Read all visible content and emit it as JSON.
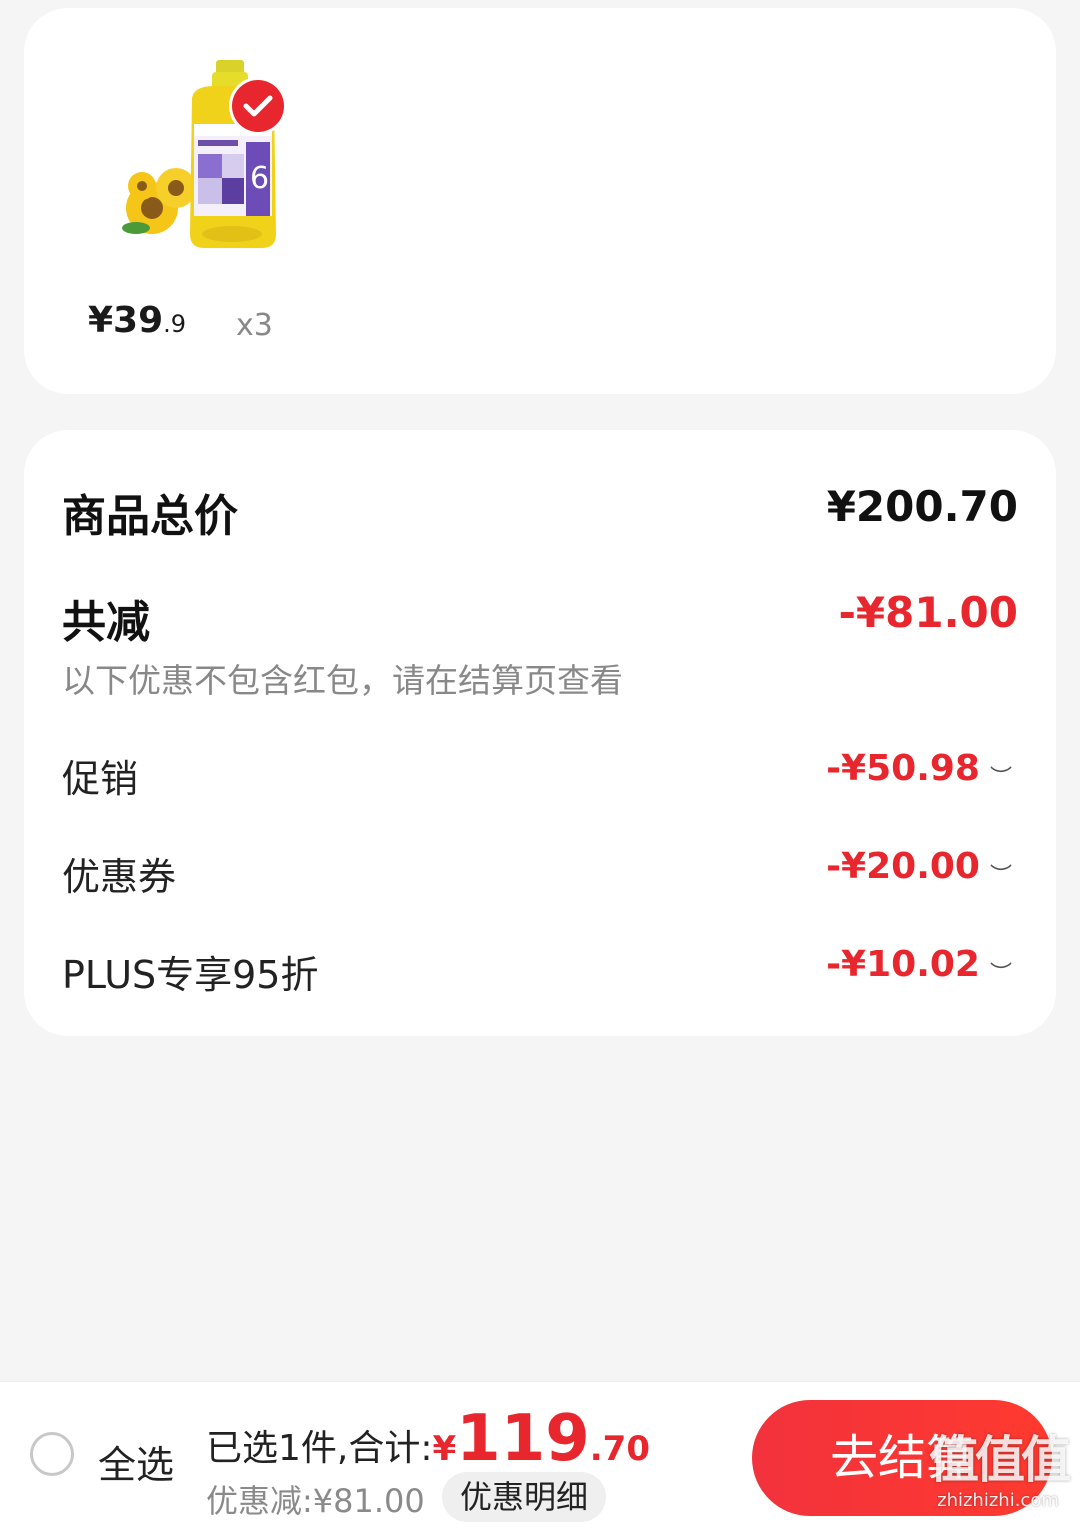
{
  "product": {
    "image_desc": "sunflower oil bottle",
    "price_main": "¥39",
    "price_decimal": ".9",
    "quantity": "x3",
    "selected": true
  },
  "summary": {
    "total_label": "商品总价",
    "total_value": "¥200.70",
    "reduction_label": "共减",
    "reduction_value": "-¥81.00",
    "note": "以下优惠不包含红包，请在结算页查看",
    "items": [
      {
        "label": "促销",
        "value": "-¥50.98"
      },
      {
        "label": "优惠券",
        "value": "-¥20.00"
      },
      {
        "label": "PLUS专享95折",
        "value": "-¥10.02"
      }
    ]
  },
  "bottom_bar": {
    "select_all": "全选",
    "selected_text": "已选1件,合计:",
    "total_currency": "¥",
    "total_int": "119",
    "total_decimal": ".70",
    "discount_text": "优惠减:¥81.00",
    "detail_label": "优惠明细",
    "checkout_label": "去结算"
  },
  "watermark": {
    "logo": "值值值",
    "url": "zhizhizhi.com"
  },
  "colors": {
    "accent": "#e8262d",
    "background": "#f5f5f5"
  }
}
